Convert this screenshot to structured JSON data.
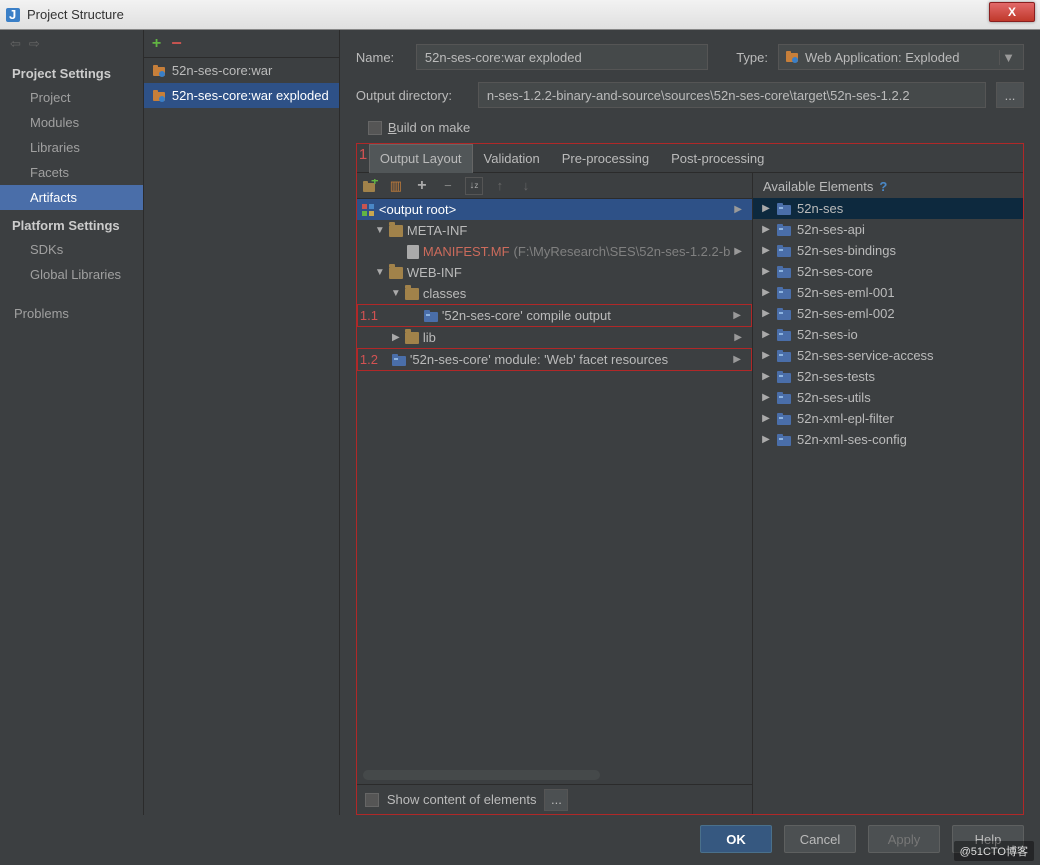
{
  "window": {
    "title": "Project Structure",
    "close": "X"
  },
  "sidebar": {
    "nav_back": "⇦",
    "nav_fwd": "⇨",
    "heading1": "Project Settings",
    "items1": [
      "Project",
      "Modules",
      "Libraries",
      "Facets",
      "Artifacts"
    ],
    "heading2": "Platform Settings",
    "items2": [
      "SDKs",
      "Global Libraries"
    ],
    "extra": "Problems"
  },
  "artifacts": {
    "list": [
      {
        "label": "52n-ses-core:war"
      },
      {
        "label": "52n-ses-core:war exploded"
      }
    ]
  },
  "form": {
    "name_label": "Name:",
    "name_value": "52n-ses-core:war exploded",
    "type_label": "Type:",
    "type_value": "Web Application: Exploded",
    "outdir_label": "Output directory:",
    "outdir_value": "n-ses-1.2.2-binary-and-source\\sources\\52n-ses-core\\target\\52n-ses-1.2.2",
    "browse": "...",
    "build_label": "Build on make"
  },
  "tabs": [
    "Output Layout",
    "Validation",
    "Pre-processing",
    "Post-processing"
  ],
  "annot": {
    "a1": "1",
    "a11": "1.1",
    "a12": "1.2"
  },
  "tree": {
    "root": "<output root>",
    "metainf": "META-INF",
    "manifest": "MANIFEST.MF",
    "manifest_path": "(F:\\MyResearch\\SES\\52n-ses-1.2.2-b",
    "webinf": "WEB-INF",
    "classes": "classes",
    "compile": "'52n-ses-core' compile output",
    "lib": "lib",
    "facet": "'52n-ses-core' module: 'Web' facet resources"
  },
  "show_content": "Show content of elements",
  "right": {
    "header": "Available Elements",
    "help": "?",
    "items": [
      "52n-ses",
      "52n-ses-api",
      "52n-ses-bindings",
      "52n-ses-core",
      "52n-ses-eml-001",
      "52n-ses-eml-002",
      "52n-ses-io",
      "52n-ses-service-access",
      "52n-ses-tests",
      "52n-ses-utils",
      "52n-xml-epl-filter",
      "52n-xml-ses-config"
    ]
  },
  "buttons": {
    "ok": "OK",
    "cancel": "Cancel",
    "apply": "Apply",
    "help": "Help"
  },
  "watermark": "@51CTO博客"
}
